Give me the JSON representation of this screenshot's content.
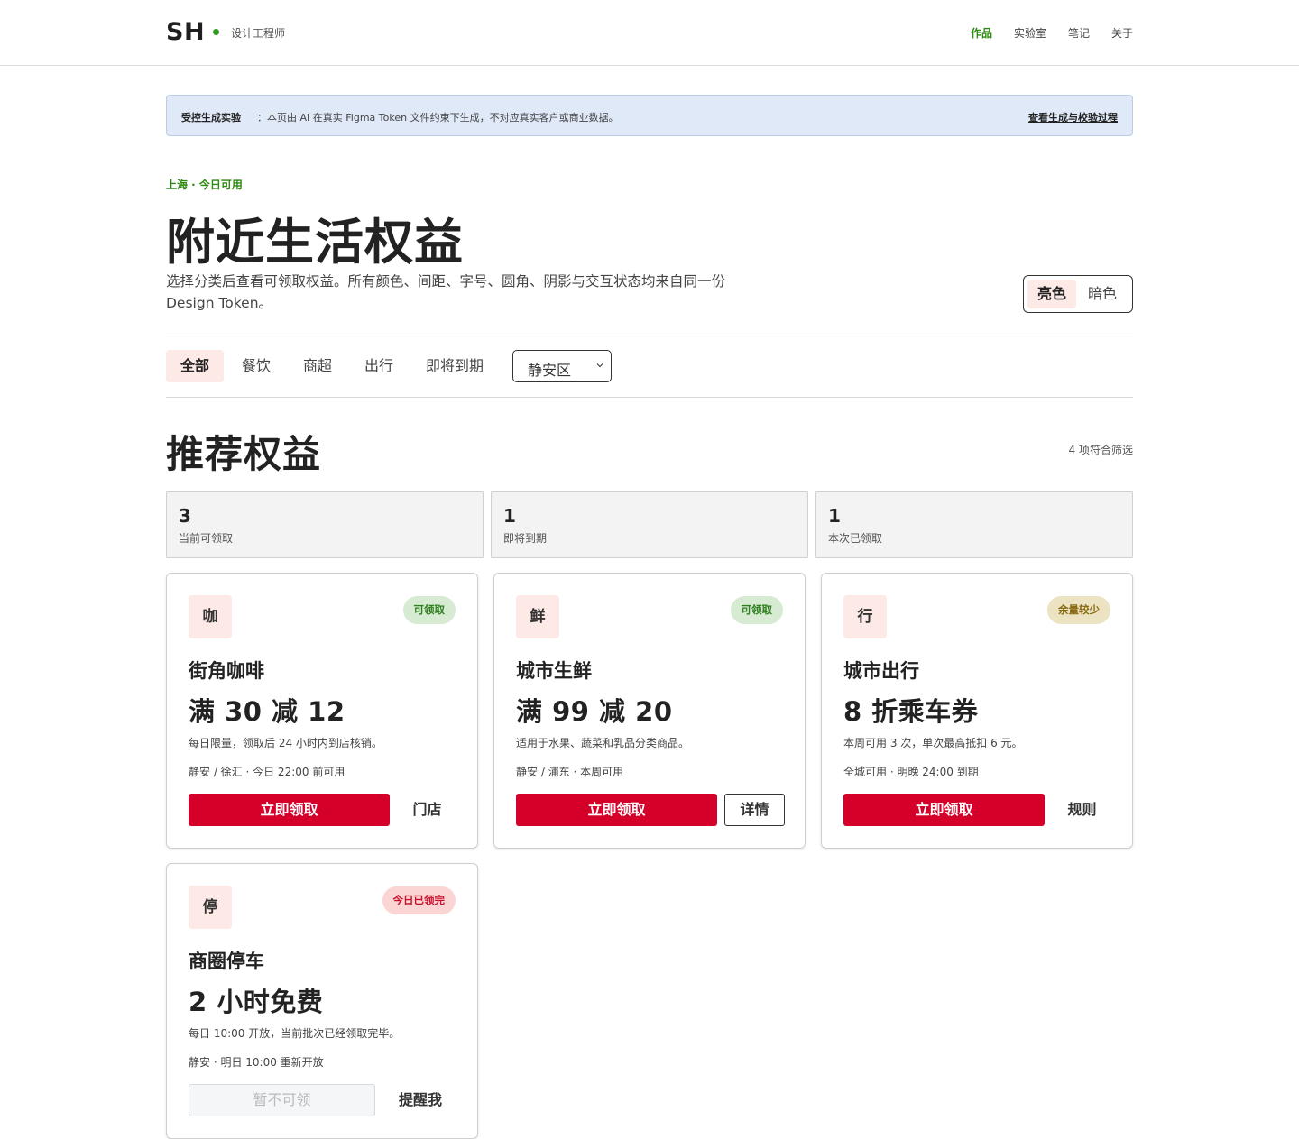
{
  "header": {
    "logo": "SH",
    "subtitle": "设计工程师",
    "nav": [
      "作品",
      "实验室",
      "笔记",
      "关于"
    ],
    "active_nav": "作品"
  },
  "notice": {
    "strong": "受控生成实验",
    "text": "：本页由 AI 在真实 Figma Token 文件约束下生成，不对应真实客户或商业数据。",
    "link": "查看生成与校验过程"
  },
  "hero": {
    "eyebrow": "上海 · 今日可用",
    "title": "附近生活权益",
    "description": "选择分类后查看可领取权益。所有颜色、间距、字号、圆角、阴影与交互状态均来自同一份 Design Token。",
    "theme": {
      "light": "亮色",
      "dark": "暗色",
      "selected": "亮色"
    }
  },
  "filters": {
    "tabs": [
      "全部",
      "餐饮",
      "商超",
      "出行",
      "即将到期"
    ],
    "active": "全部",
    "district": "静安区"
  },
  "section": {
    "title": "推荐权益",
    "count": "4 项符合筛选"
  },
  "stats": [
    {
      "value": "3",
      "label": "当前可领取"
    },
    {
      "value": "1",
      "label": "即将到期"
    },
    {
      "value": "1",
      "label": "本次已领取"
    }
  ],
  "cards": [
    {
      "icon_char": "咖",
      "badge": "可领取",
      "title": "街角咖啡",
      "offer": "满 30 减 12",
      "description": "每日限量，领取后 24 小时内到店核销。",
      "meta": "静安 / 徐汇 · 今日 22:00 前可用",
      "primary": "立即领取",
      "secondary": "门店"
    },
    {
      "icon_char": "鲜",
      "badge": "可领取",
      "title": "城市生鲜",
      "offer": "满 99 减 20",
      "description": "适用于水果、蔬菜和乳品分类商品。",
      "meta": "静安 / 浦东 · 本周可用",
      "primary": "立即领取",
      "secondary": "详情"
    },
    {
      "icon_char": "行",
      "badge": "余量较少",
      "title": "城市出行",
      "offer": "8 折乘车券",
      "description": "本周可用 3 次，单次最高抵扣 6 元。",
      "meta": "全城可用 · 明晚 24:00 到期",
      "primary": "立即领取",
      "secondary": "规则"
    },
    {
      "icon_char": "停",
      "badge": "今日已领完",
      "title": "商圈停车",
      "offer": "2 小时免费",
      "description": "每日 10:00 开放，当前批次已经领取完毕。",
      "meta": "静安 · 明日 10:00 重新开放",
      "primary": "暂不可领",
      "secondary": "提醒我"
    }
  ],
  "colors": {
    "accent_green": "#2e8b12",
    "primary_red": "#d4002a",
    "notice_bg": "#dfe9f7",
    "tint_pink": "#fde9e6"
  }
}
